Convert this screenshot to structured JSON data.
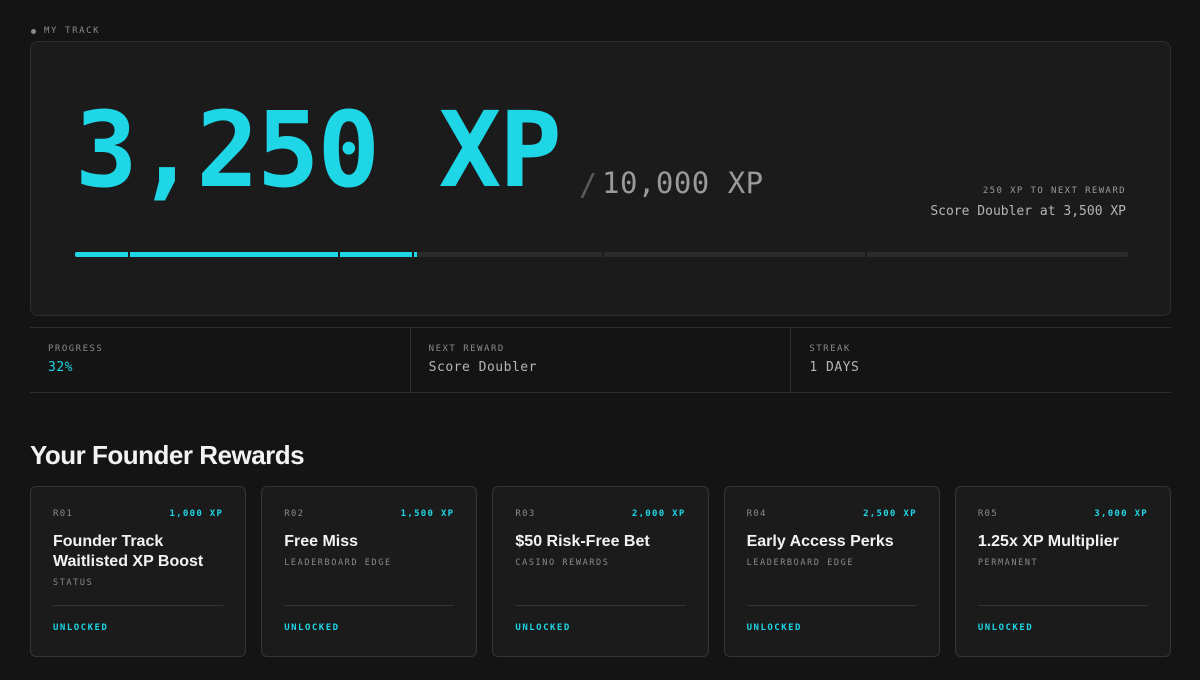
{
  "section_label": "MY TRACK",
  "hero": {
    "xp_current": "3,250 XP",
    "slash": "/",
    "xp_total": "10,000 XP",
    "to_next": "250 XP TO NEXT REWARD",
    "next_desc": "Score Doubler at 3,500 XP",
    "progress_fraction": 0.325,
    "milestone_fractions": [
      0.05,
      0.25,
      0.32,
      0.5,
      0.75
    ],
    "accent_color": "#1ed6e6"
  },
  "stats": [
    {
      "label": "PROGRESS",
      "value": "32%"
    },
    {
      "label": "NEXT REWARD",
      "value": "Score Doubler"
    },
    {
      "label": "STREAK",
      "value": "1 DAYS"
    }
  ],
  "rewards_title": "Your Founder Rewards",
  "rewards": [
    {
      "code": "R01",
      "cost": "1,000 XP",
      "title": "Founder Track Waitlisted XP Boost",
      "category": "STATUS",
      "status": "UNLOCKED"
    },
    {
      "code": "R02",
      "cost": "1,500 XP",
      "title": "Free Miss",
      "category": "LEADERBOARD EDGE",
      "status": "UNLOCKED"
    },
    {
      "code": "R03",
      "cost": "2,000 XP",
      "title": "$50 Risk-Free Bet",
      "category": "CASINO REWARDS",
      "status": "UNLOCKED"
    },
    {
      "code": "R04",
      "cost": "2,500 XP",
      "title": "Early Access Perks",
      "category": "LEADERBOARD EDGE",
      "status": "UNLOCKED"
    },
    {
      "code": "R05",
      "cost": "3,000 XP",
      "title": "1.25x XP Multiplier",
      "category": "PERMANENT",
      "status": "UNLOCKED"
    }
  ]
}
